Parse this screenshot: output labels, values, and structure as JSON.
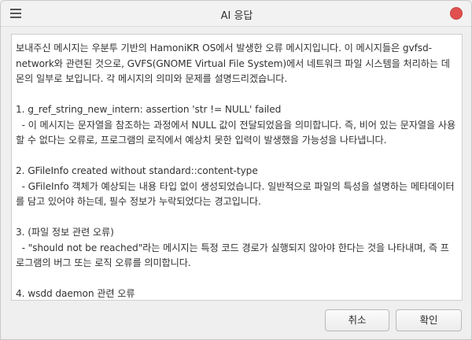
{
  "window": {
    "title": "AI 응답",
    "menu_icon": "hamburger-menu-icon",
    "close_icon": "close-icon",
    "close_color": "#e0504f"
  },
  "response": {
    "paragraphs": [
      "보내주신 메시지는 우분투 기반의 HamoniKR OS에서 발생한 오류 메시지입니다. 이 메시지들은 gvfsd-network와 관련된 것으로, GVFS(GNOME Virtual File System)에서 네트워크 파일 시스템을 처리하는 데몬의 일부로 보입니다. 각 메시지의 의미와 문제를 설명드리겠습니다.",
      "1. g_ref_string_new_intern: assertion 'str != NULL' failed\n  - 이 메시지는 문자열을 참조하는 과정에서 NULL 값이 전달되었음을 의미합니다. 즉, 비어 있는 문자열을 사용할 수 없다는 오류로, 프로그램의 로직에서 예상치 못한 입력이 발생했을 가능성을 나타냅니다.",
      "2. GFileInfo created without standard::content-type\n  - GFileInfo 객체가 예상되는 내용 타입 없이 생성되었습니다. 일반적으로 파일의 특성을 설명하는 메타데이터를 담고 있어야 하는데, 필수 정보가 누락되었다는 경고입니다.",
      "3. (파일 정보 관련 오류)\n  - \"should not be reached\"라는 메시지는 특정 코드 경로가 실행되지 않아야 한다는 것을 나타내며, 즉 프로그램의 버그 또는 로직 오류를 의미합니다.",
      "4. wsdd daemon 관련 오류"
    ]
  },
  "buttons": {
    "cancel_label": "취소",
    "ok_label": "확인"
  }
}
